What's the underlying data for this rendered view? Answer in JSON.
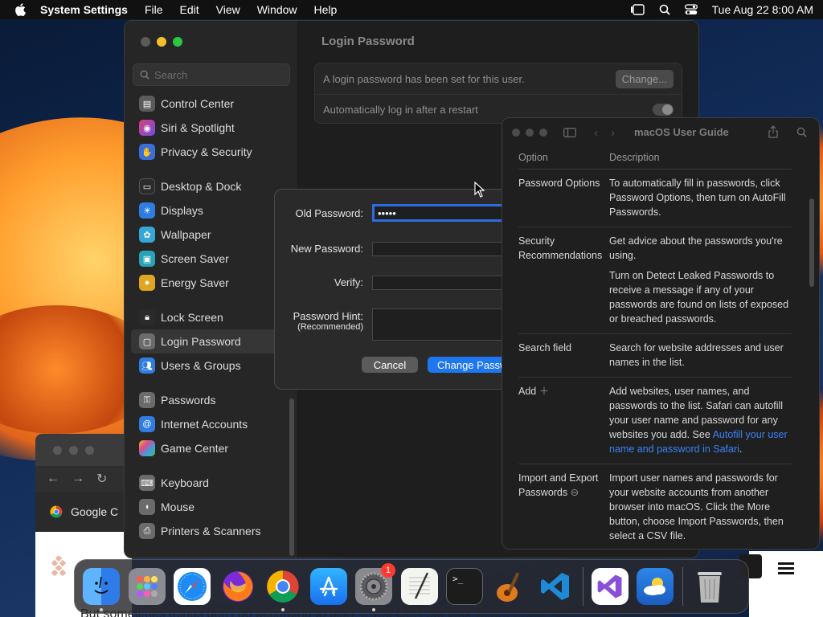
{
  "menubar": {
    "app_name": "System Settings",
    "items": [
      "File",
      "Edit",
      "View",
      "Window",
      "Help"
    ],
    "datetime": "Tue Aug 22  8:00 AM"
  },
  "settings": {
    "search_placeholder": "Search",
    "sidebar": [
      {
        "label": "Control Center",
        "icon": "control-center-icon",
        "color": "#5b5b5b"
      },
      {
        "label": "Siri & Spotlight",
        "icon": "siri-icon",
        "color": "#c2389c"
      },
      {
        "label": "Privacy & Security",
        "icon": "hand-icon",
        "color": "#3a6fd8"
      },
      {
        "label": "Desktop & Dock",
        "icon": "dock-icon",
        "color": "#2b2b2b"
      },
      {
        "label": "Displays",
        "icon": "sun-icon",
        "color": "#2f7de0"
      },
      {
        "label": "Wallpaper",
        "icon": "flower-icon",
        "color": "#36a6d8"
      },
      {
        "label": "Screen Saver",
        "icon": "screensaver-icon",
        "color": "#2aa3b8"
      },
      {
        "label": "Energy Saver",
        "icon": "bulb-icon",
        "color": "#e0a522"
      },
      {
        "label": "Lock Screen",
        "icon": "lock-icon",
        "color": "#2b2b2b"
      },
      {
        "label": "Login Password",
        "icon": "login-lock-icon",
        "color": "#6b6b6b"
      },
      {
        "label": "Users & Groups",
        "icon": "users-icon",
        "color": "#2f7de0"
      },
      {
        "label": "Passwords",
        "icon": "key-icon",
        "color": "#6b6b6b"
      },
      {
        "label": "Internet Accounts",
        "icon": "at-icon",
        "color": "#2f7de0"
      },
      {
        "label": "Game Center",
        "icon": "game-center-icon",
        "color": "#e04a8a"
      },
      {
        "label": "Keyboard",
        "icon": "keyboard-icon",
        "color": "#6b6b6b"
      },
      {
        "label": "Mouse",
        "icon": "mouse-icon",
        "color": "#6b6b6b"
      },
      {
        "label": "Printers & Scanners",
        "icon": "printer-icon",
        "color": "#6b6b6b"
      }
    ],
    "content": {
      "title": "Login Password",
      "row1_text": "A login password has been set for this user.",
      "change_button": "Change...",
      "row2_text": "Automatically log in after a restart"
    }
  },
  "sheet": {
    "old_label": "Old Password:",
    "old_value": "•••••",
    "new_label": "New Password:",
    "verify_label": "Verify:",
    "hint_label": "Password Hint:",
    "hint_sub": "(Recommended)",
    "cancel": "Cancel",
    "primary": "Change Password"
  },
  "help": {
    "title": "macOS User Guide",
    "col_option": "Option",
    "col_description": "Description",
    "rows": [
      {
        "option": "Password Options",
        "desc": "To automatically fill in passwords, click Password Options, then turn on AutoFill Passwords."
      },
      {
        "option": "Security Recommendations",
        "desc": "Get advice about the passwords you're using.",
        "desc2": "Turn on Detect Leaked Passwords to receive a message if any of your passwords are found on lists of exposed or breached passwords."
      },
      {
        "option": "Search field",
        "desc": "Search for website addresses and user names in the list."
      },
      {
        "option": "Add",
        "desc": "Add websites, user names, and passwords to the list. Safari can autofill your user name and password for any websites you add. See ",
        "link": "Autofill your user name and password in Safari",
        "desc_end": "."
      },
      {
        "option": "Import and Export Passwords",
        "desc": "Import user names and passwords for your website accounts from another browser into macOS. Click the More button, choose Import Passwords, then select a CSV file."
      }
    ]
  },
  "browser": {
    "tab_title": "Google C",
    "page_text": "But sometimes things don't go according to plan. If you can't get your Mac's Erase Assistant to work with"
  },
  "dock": {
    "apps": [
      {
        "name": "Finder",
        "icon": "finder-icon",
        "running": true
      },
      {
        "name": "Launchpad",
        "icon": "launchpad-icon",
        "running": false
      },
      {
        "name": "Safari",
        "icon": "safari-icon",
        "running": false
      },
      {
        "name": "Firefox",
        "icon": "firefox-icon",
        "running": false
      },
      {
        "name": "Chrome",
        "icon": "chrome-icon",
        "running": true
      },
      {
        "name": "App Store",
        "icon": "app-store-icon",
        "running": false
      },
      {
        "name": "System Settings",
        "icon": "system-settings-icon",
        "running": true,
        "badge": "1"
      },
      {
        "name": "TextEdit",
        "icon": "textedit-icon",
        "running": false
      },
      {
        "name": "Terminal",
        "icon": "terminal-icon",
        "running": false
      },
      {
        "name": "GarageBand",
        "icon": "garageband-icon",
        "running": false
      },
      {
        "name": "VS Code",
        "icon": "vscode-icon",
        "running": false
      },
      {
        "name": "Visual Studio",
        "icon": "visual-studio-icon",
        "running": false
      },
      {
        "name": "Weather",
        "icon": "weather-icon",
        "running": false
      },
      {
        "name": "Trash",
        "icon": "trash-icon",
        "running": false
      }
    ]
  }
}
